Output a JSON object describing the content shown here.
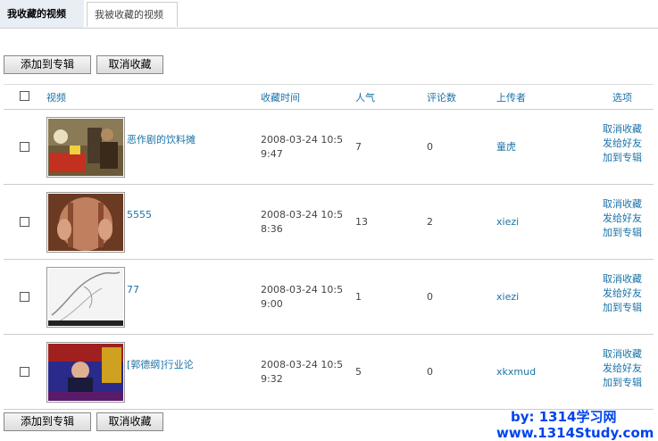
{
  "tabs": {
    "my_favorites": "我收藏的视频",
    "favorited_by_others": "我被收藏的视频"
  },
  "actions": {
    "add_to_album": "添加到专辑",
    "cancel_favorite": "取消收藏"
  },
  "columns": {
    "video": "视频",
    "favorited_time": "收藏时间",
    "popularity": "人气",
    "comments": "评论数",
    "uploader": "上传者",
    "options": "选项"
  },
  "rows": [
    {
      "title": "恶作剧的饮料摊",
      "time": "2008-03-24 10:59:47",
      "popularity": "7",
      "comments": "0",
      "uploader": "童虎"
    },
    {
      "title": "5555",
      "time": "2008-03-24 10:58:36",
      "popularity": "13",
      "comments": "2",
      "uploader": "xiezi"
    },
    {
      "title": "77",
      "time": "2008-03-24 10:59:00",
      "popularity": "1",
      "comments": "0",
      "uploader": "xiezi"
    },
    {
      "title": "[郭德纲]行业论",
      "time": "2008-03-24 10:59:32",
      "popularity": "5",
      "comments": "0",
      "uploader": "xkxmud"
    }
  ],
  "row_options": {
    "cancel": "取消收藏",
    "send_friend": "发给好友",
    "add_album": "加到专辑"
  },
  "watermark": {
    "line1": "by: 1314学习网",
    "line2": "www.1314Study.com"
  }
}
